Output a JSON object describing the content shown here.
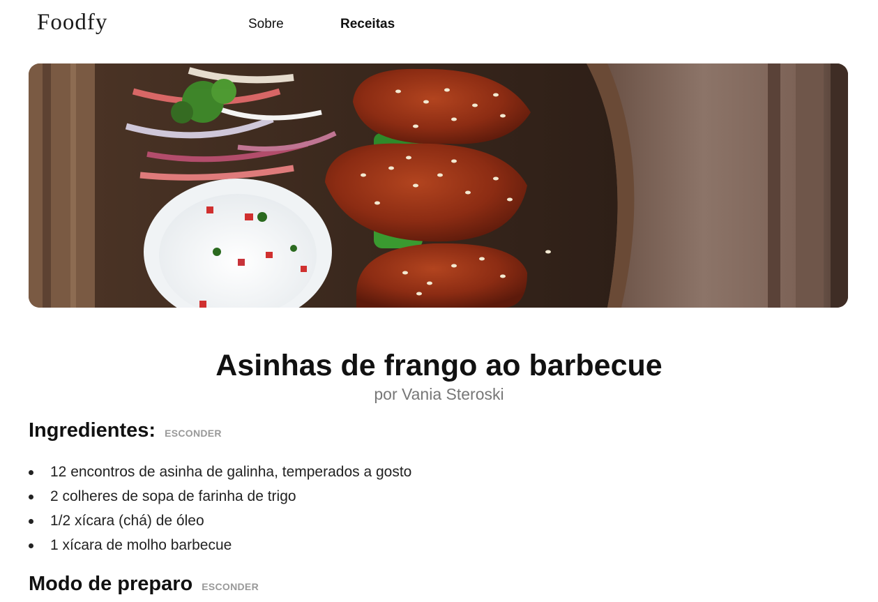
{
  "header": {
    "logo": "Foodfy",
    "nav": [
      {
        "label": "Sobre",
        "active": false
      },
      {
        "label": "Receitas",
        "active": true
      }
    ]
  },
  "recipe": {
    "title": "Asinhas de frango ao barbecue",
    "author": "por Vania Steroski",
    "ingredients_title": "Ingredientes:",
    "ingredients_toggle": "ESCONDER",
    "ingredients": [
      "12 encontros de asinha de galinha, temperados a gosto",
      "2 colheres de sopa de farinha de trigo",
      "1/2 xícara (chá) de óleo",
      "1 xícara de molho barbecue"
    ],
    "preparation_title": "Modo de preparo",
    "preparation_toggle": "ESCONDER"
  },
  "colors": {
    "text": "#111111",
    "muted": "#777777",
    "toggle": "#999999",
    "wood_dark": "#3b2a20",
    "wood_light": "#8a6e60",
    "sauce": "#8a2a12"
  }
}
